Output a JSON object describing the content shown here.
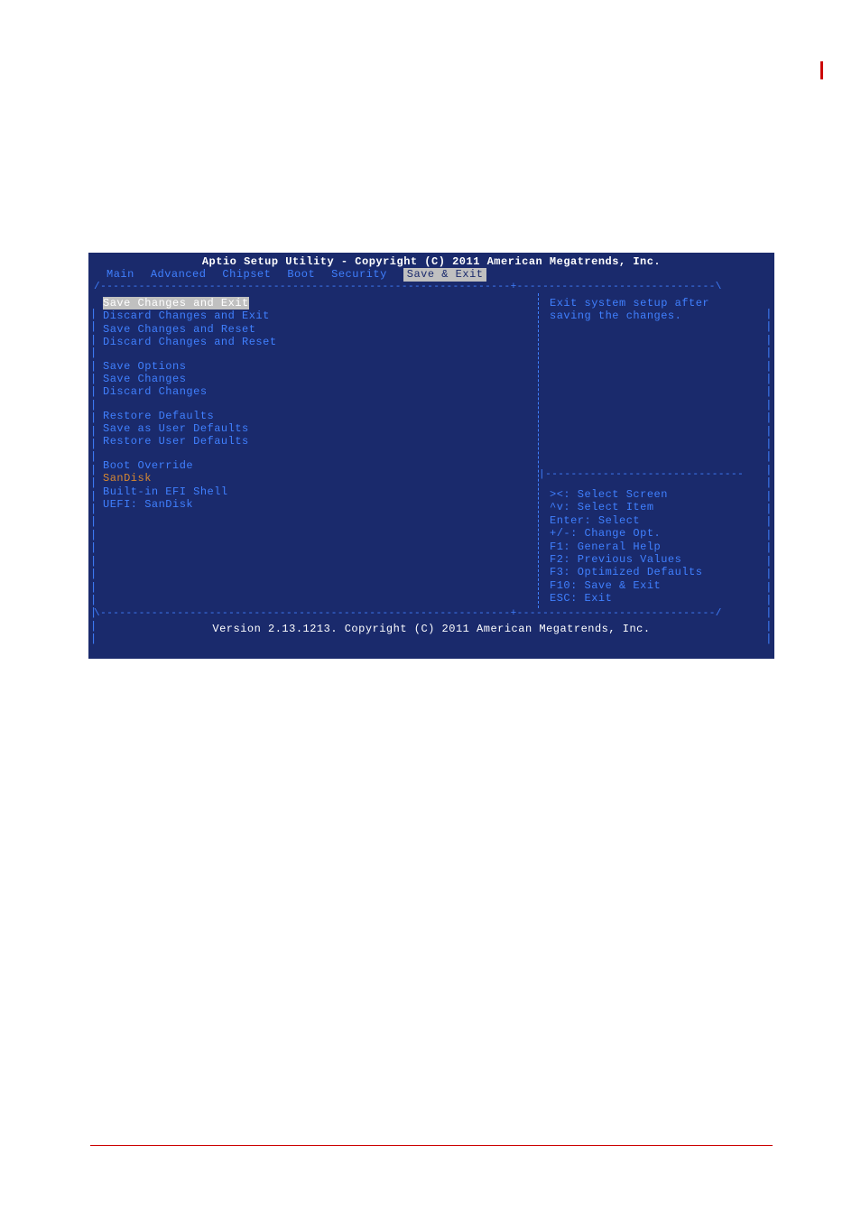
{
  "header": {
    "title": "Aptio Setup Utility - Copyright (C) 2011 American Megatrends, Inc."
  },
  "tabs": {
    "main": "Main",
    "advanced": "Advanced",
    "chipset": "Chipset",
    "boot": "Boot",
    "security": "Security",
    "save_exit": "Save & Exit"
  },
  "menu": {
    "save_changes_exit": "Save Changes and Exit",
    "discard_changes_exit": "Discard Changes and Exit",
    "save_changes_reset": "Save Changes and Reset",
    "discard_changes_reset": "Discard Changes and Reset",
    "save_options_header": "Save Options",
    "save_changes": "Save Changes",
    "discard_changes": "Discard Changes",
    "restore_defaults": "Restore Defaults",
    "save_user_defaults": "Save as User Defaults",
    "restore_user_defaults": "Restore User Defaults",
    "boot_override_header": "Boot Override",
    "boot_sandisk": "SanDisk",
    "boot_efi_shell": "Built-in EFI Shell",
    "boot_uefi_sandisk": "UEFI: SanDisk"
  },
  "help": {
    "description": "Exit system setup after saving the changes."
  },
  "keys": {
    "select_screen": "><: Select Screen",
    "select_item": "^v: Select Item",
    "enter_select": "Enter: Select",
    "change_opt": "+/-: Change Opt.",
    "general_help": "F1: General Help",
    "previous_values": "F2: Previous Values",
    "optimized_defaults": "F3: Optimized Defaults",
    "save_exit": "F10: Save & Exit",
    "esc_exit": "ESC: Exit"
  },
  "footer": {
    "version": "Version 2.13.1213. Copyright (C) 2011 American Megatrends, Inc."
  },
  "borders": {
    "top_divider": "/----------------------------------------------------------------+-------------------------------\\",
    "bottom_divider": "\\----------------------------------------------------------------+-------------------------------/",
    "right_divider": "|-------------------------------"
  }
}
